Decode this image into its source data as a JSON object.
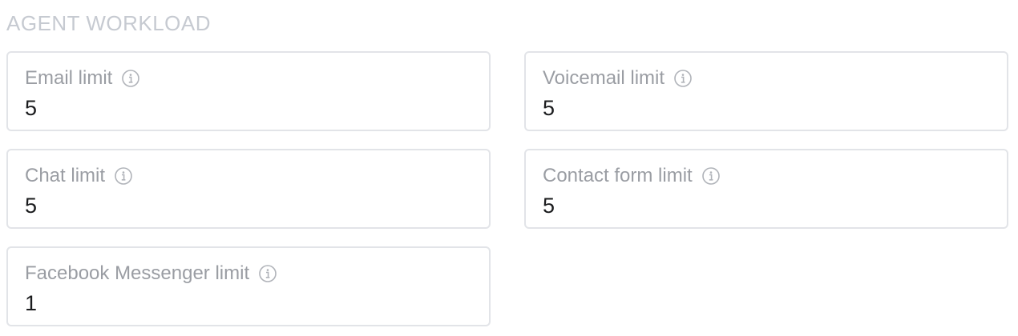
{
  "section": {
    "title": "AGENT WORKLOAD"
  },
  "fields": {
    "email": {
      "label": "Email limit",
      "value": "5",
      "icon": "info-icon"
    },
    "voicemail": {
      "label": "Voicemail limit",
      "value": "5",
      "icon": "info-icon"
    },
    "chat": {
      "label": "Chat limit",
      "value": "5",
      "icon": "info-icon"
    },
    "contact": {
      "label": "Contact form limit",
      "value": "5",
      "icon": "info-icon"
    },
    "facebook": {
      "label": "Facebook Messenger limit",
      "value": "1",
      "icon": "info-icon"
    }
  },
  "colors": {
    "section_title": "#c6cad1",
    "label": "#9a9da3",
    "value": "#1b1c1e",
    "border": "#e2e4e8",
    "icon": "#b0b3b9"
  }
}
